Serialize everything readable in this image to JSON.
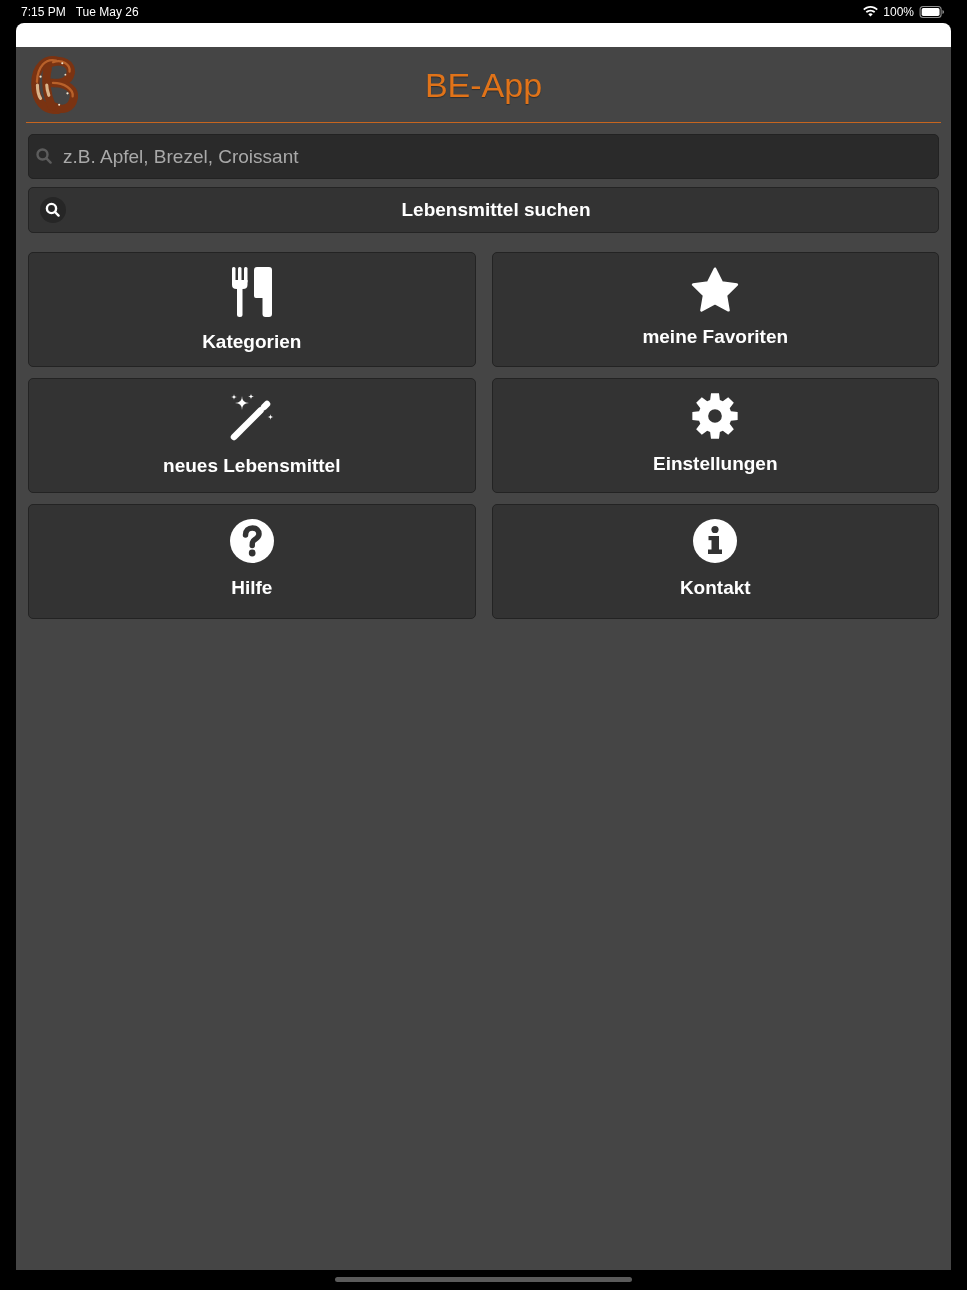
{
  "status_bar": {
    "time": "7:15 PM",
    "date": "Tue May 26",
    "battery": "100%"
  },
  "header": {
    "title": "BE-App"
  },
  "search": {
    "placeholder": "z.B. Apfel, Brezel, Croissant"
  },
  "search_button": {
    "label": "Lebensmittel suchen"
  },
  "menu": [
    {
      "label": "Kategorien"
    },
    {
      "label": "meine Favoriten"
    },
    {
      "label": "neues Lebensmittel"
    },
    {
      "label": "Einstellungen"
    },
    {
      "label": "Hilfe"
    },
    {
      "label": "Kontakt"
    }
  ]
}
